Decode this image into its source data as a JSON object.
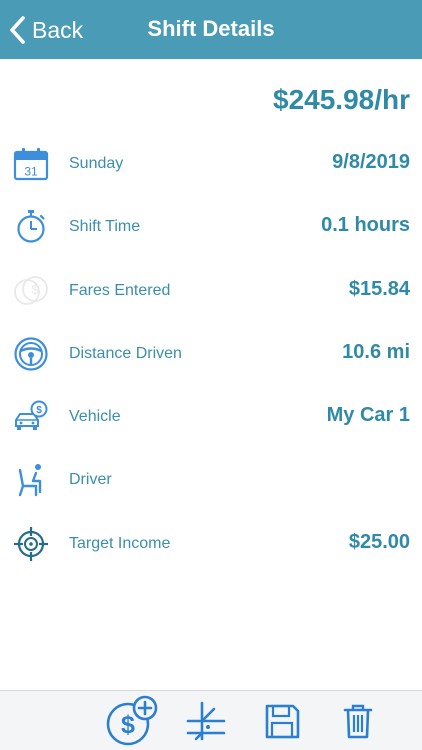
{
  "navbar": {
    "back_label": "Back",
    "title": "Shift Details"
  },
  "summary": {
    "hourly_rate": "$245.98/hr"
  },
  "details": [
    {
      "icon": "calendar-icon",
      "label": "Sunday",
      "value": "9/8/2019"
    },
    {
      "icon": "stopwatch-icon",
      "label": "Shift Time",
      "value": "0.1 hours"
    },
    {
      "icon": "coins-icon",
      "label": "Fares Entered",
      "value": "$15.84"
    },
    {
      "icon": "steering-wheel-icon",
      "label": "Distance Driven",
      "value": "10.6 mi"
    },
    {
      "icon": "car-dollar-icon",
      "label": "Vehicle",
      "value": "My Car 1"
    },
    {
      "icon": "driver-seat-icon",
      "label": "Driver",
      "value": ""
    },
    {
      "icon": "target-icon",
      "label": "Target Income",
      "value": "$25.00"
    }
  ],
  "toolbar": {
    "add_fare_icon": "dollar-plus-icon",
    "split_icon": "road-split-icon",
    "save_icon": "floppy-disk-icon",
    "delete_icon": "trash-icon"
  },
  "colors": {
    "navbar": "#4a9bb6",
    "accent": "#2f8aa8",
    "icon_blue": "#3d8fdc",
    "toolbar_bg": "#f4f5f6"
  }
}
